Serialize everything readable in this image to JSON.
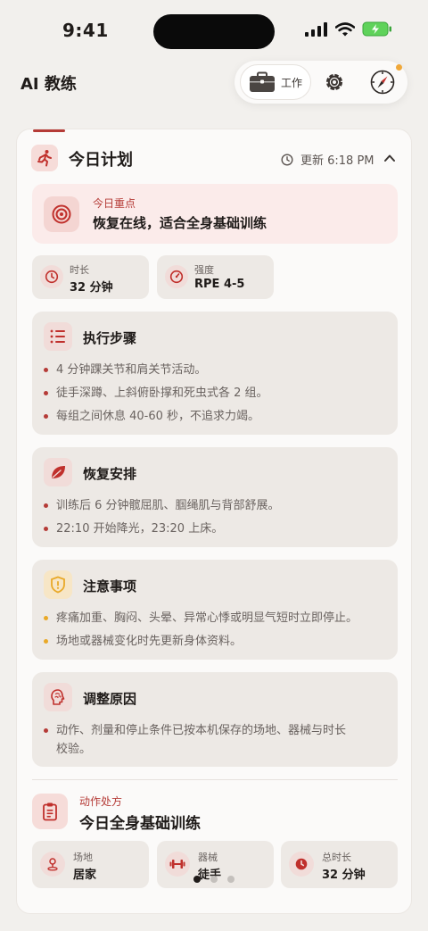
{
  "status_bar": {
    "time": "9:41"
  },
  "header": {
    "title": "AI 教练"
  },
  "toolbar": {
    "work_label": "工作"
  },
  "plan": {
    "title": "今日计划",
    "updated": "更新 6:18 PM",
    "focus": {
      "label": "今日重点",
      "text": "恢复在线，适合全身基础训练"
    },
    "metrics": [
      {
        "label": "时长",
        "value": "32 分钟"
      },
      {
        "label": "强度",
        "value": "RPE 4-5"
      }
    ],
    "sections": [
      {
        "title": "执行步骤",
        "items": [
          "4 分钟踝关节和肩关节活动。",
          "徒手深蹲、上斜俯卧撑和死虫式各 2 组。",
          "每组之间休息 40-60 秒，不追求力竭。"
        ]
      },
      {
        "title": "恢复安排",
        "items": [
          "训练后 6 分钟髋屈肌、腘绳肌与背部舒展。",
          "22:10 开始降光，23:20 上床。"
        ]
      },
      {
        "title": "注意事项",
        "items": [
          "疼痛加重、胸闷、头晕、异常心悸或明显气短时立即停止。",
          "场地或器械变化时先更新身体资料。"
        ]
      },
      {
        "title": "调整原因",
        "items": [
          "动作、剂量和停止条件已按本机保存的场地、器械与时长校验。"
        ]
      }
    ],
    "prescription": {
      "label": "动作处方",
      "title": "今日全身基础训练",
      "info": [
        {
          "label": "场地",
          "value": "居家"
        },
        {
          "label": "器械",
          "value": "徒手"
        },
        {
          "label": "总时长",
          "value": "32 分钟"
        }
      ]
    }
  },
  "colors": {
    "accent": "#b53b37",
    "warning": "#e9a928",
    "background": "#f2f0ed",
    "card": "#fbfaf9"
  }
}
